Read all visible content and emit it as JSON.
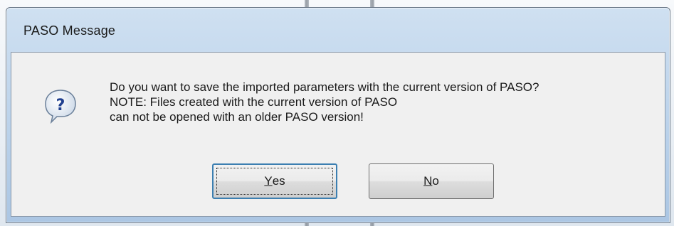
{
  "dialog": {
    "title": "PASO Message",
    "icon": "question-icon",
    "message_lines": [
      "Do you want to save the imported parameters with the current version of PASO?",
      "NOTE: Files created with the current version of PASO",
      "can not be opened with an older PASO version!"
    ],
    "buttons": {
      "yes": {
        "mnemonic": "Y",
        "rest": "es"
      },
      "no": {
        "mnemonic": "N",
        "rest": "o"
      }
    },
    "default_button": "yes"
  }
}
